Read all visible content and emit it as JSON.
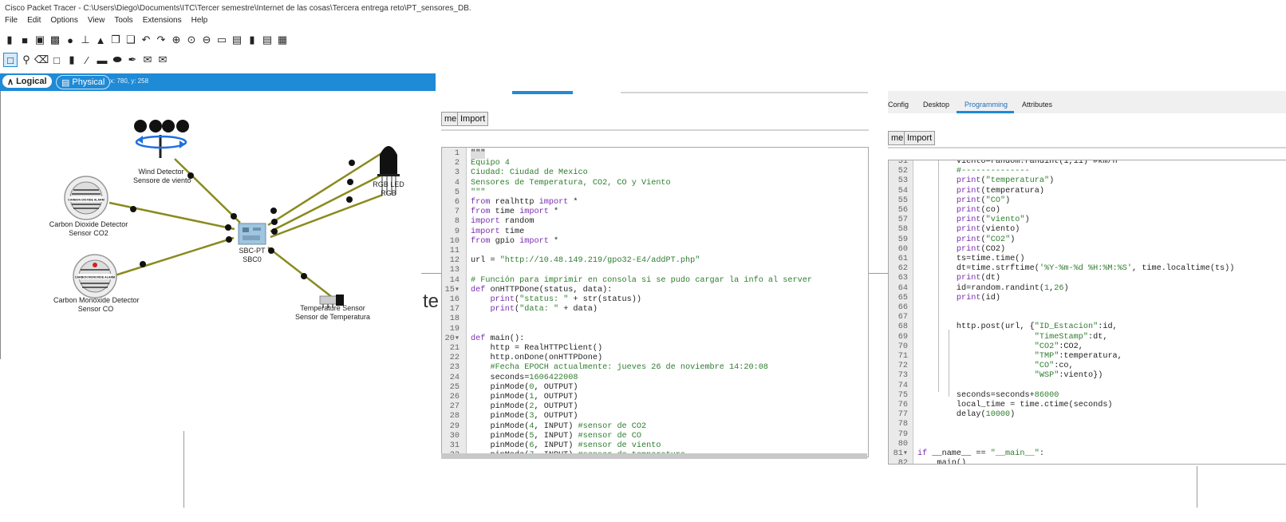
{
  "packet_tracer": {
    "title": "Cisco Packet Tracer - C:\\Users\\Diego\\Documents\\ITC\\Tercer semestre\\Internet de las cosas\\Tercera entrega reto\\PT_sensores_DB.",
    "menu": [
      "File",
      "Edit",
      "Options",
      "View",
      "Tools",
      "Extensions",
      "Help"
    ],
    "tabs": {
      "logical": "Logical",
      "physical": "Physical"
    },
    "coords": "x: 780, y: 258",
    "devices": {
      "wind_line1": "Wind Detector",
      "wind_line2": "Sensore de viento",
      "co2_line1": "Carbon Dioxide Detector",
      "co2_line2": "Sensor CO2",
      "co_line1": "Carbon Monoxide Detector",
      "co_line2": "Sensor CO",
      "sbc_line1": "SBC-PT",
      "sbc_line2": "SBC0",
      "led_line1": "RGB LED",
      "led_line2": "RGB",
      "temp_line1": "Temperature Sensor",
      "temp_line2": "Sensor de Temperatura",
      "co2_badge": "CARBON DIOXIDE ALARM",
      "co_badge": "CARBON MONOXIDE ALARM"
    }
  },
  "stray_text": "te",
  "editor1": {
    "rename_button": "me",
    "import_button": "Import"
  },
  "editor2": {
    "tabs": [
      "Config",
      "Desktop",
      "Programming",
      "Attributes"
    ],
    "rename_button": "me",
    "import_button": "Import"
  },
  "colors": {
    "accent": "#1f8ad6",
    "wire": "#8a8a1e",
    "keyword": "#7a2fb0",
    "string": "#2e7d2e"
  }
}
